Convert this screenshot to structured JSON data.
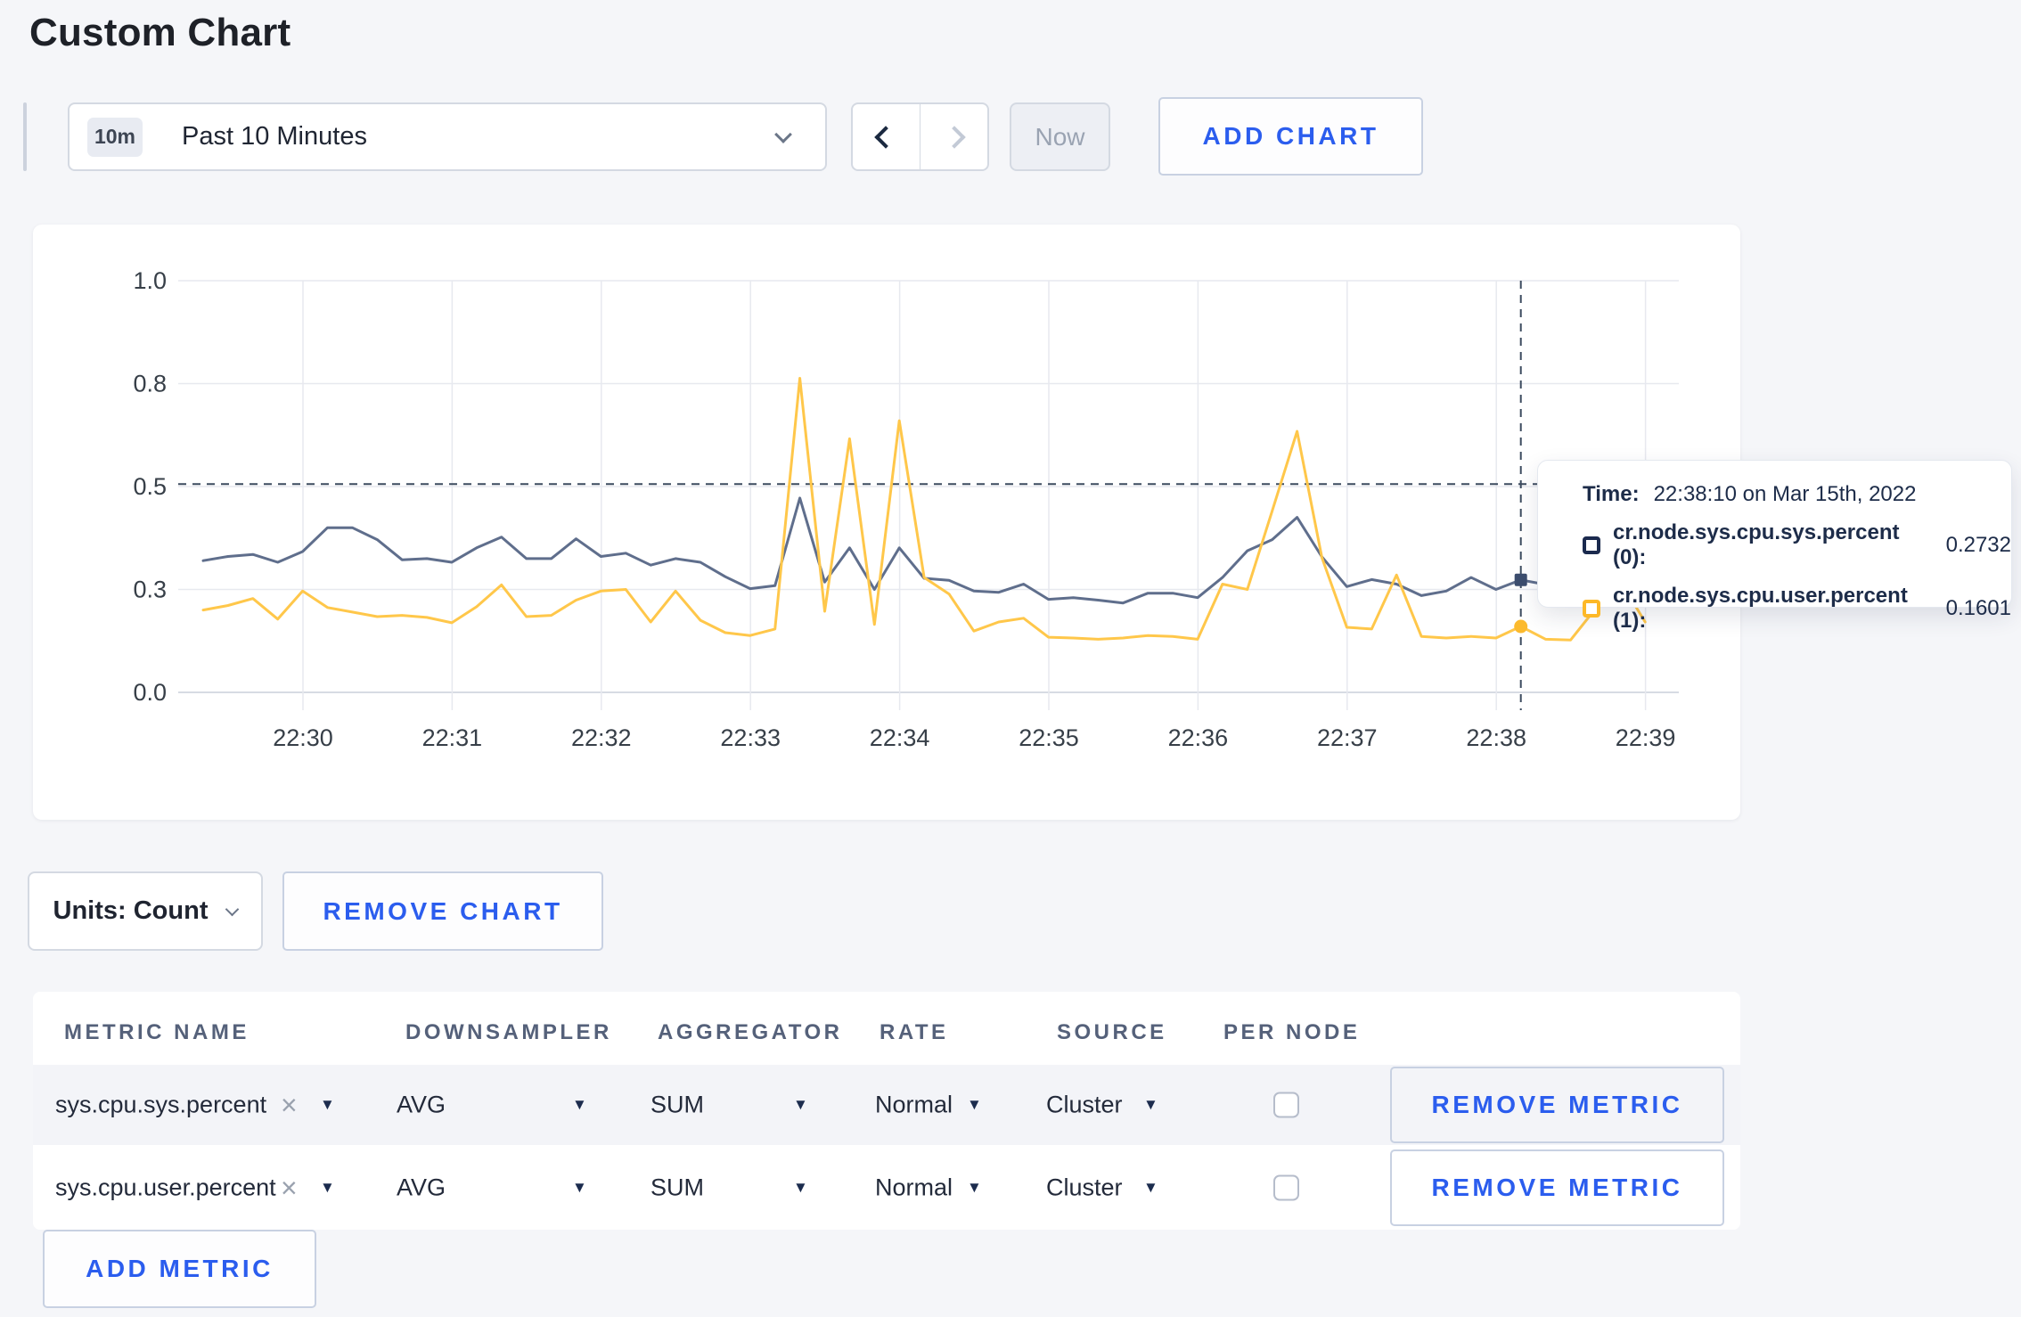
{
  "page": {
    "title": "Custom Chart",
    "background": "#f5f6f9",
    "accent_blue": "#2b5dee"
  },
  "icons": {
    "close": "×",
    "caret": "▼"
  },
  "toolbar": {
    "time_range": {
      "badge": "10m",
      "label": "Past 10 Minutes"
    },
    "now_label": "Now",
    "add_chart_label": "ADD CHART"
  },
  "tooltip": {
    "time_label": "Time:",
    "time_value": "22:38:10 on Mar 15th, 2022",
    "rows": [
      {
        "name": "cr.node.sys.cpu.sys.percent (0):",
        "value": "0.2732",
        "swatch": "#1b2a4e"
      },
      {
        "name": "cr.node.sys.cpu.user.percent (1):",
        "value": "0.1601",
        "swatch": "#fdb827"
      }
    ]
  },
  "units_row": {
    "units_label": "Units: Count",
    "remove_chart_label": "REMOVE CHART"
  },
  "metrics_table": {
    "columns": [
      "METRIC NAME",
      "DOWNSAMPLER",
      "AGGREGATOR",
      "RATE",
      "SOURCE",
      "PER NODE"
    ],
    "rows": [
      {
        "metric": "sys.cpu.sys.percent",
        "downsampler": "AVG",
        "aggregator": "SUM",
        "rate": "Normal",
        "source": "Cluster",
        "per_node_checked": false,
        "remove_label": "REMOVE METRIC"
      },
      {
        "metric": "sys.cpu.user.percent",
        "downsampler": "AVG",
        "aggregator": "SUM",
        "rate": "Normal",
        "source": "Cluster",
        "per_node_checked": false,
        "remove_label": "REMOVE METRIC"
      }
    ],
    "add_metric_label": "ADD METRIC"
  },
  "chart_data": {
    "type": "line",
    "title": "",
    "xlabel": "",
    "ylabel": "",
    "ylim": [
      0,
      1
    ],
    "grid": true,
    "x_start": "22:29:20",
    "x_step_seconds": 10,
    "x_tick_labels": [
      "22:30",
      "22:31",
      "22:32",
      "22:33",
      "22:34",
      "22:35",
      "22:36",
      "22:37",
      "22:38",
      "22:39"
    ],
    "y_tick_labels": [
      "0.0",
      "0.3",
      "0.5",
      "0.8",
      "1.0"
    ],
    "y_tick_values": [
      0,
      0.25,
      0.5,
      0.75,
      1.0
    ],
    "series": [
      {
        "name": "cr.node.sys.cpu.sys.percent",
        "color": "#5f6e8c",
        "marker_color": "#3c4d6e",
        "values": [
          0.32,
          0.33,
          0.335,
          0.316,
          0.342,
          0.4,
          0.4,
          0.371,
          0.322,
          0.325,
          0.316,
          0.351,
          0.377,
          0.325,
          0.325,
          0.373,
          0.33,
          0.338,
          0.309,
          0.325,
          0.316,
          0.281,
          0.252,
          0.259,
          0.472,
          0.268,
          0.351,
          0.25,
          0.351,
          0.277,
          0.272,
          0.246,
          0.243,
          0.263,
          0.226,
          0.23,
          0.224,
          0.217,
          0.241,
          0.241,
          0.23,
          0.279,
          0.344,
          0.371,
          0.425,
          0.329,
          0.257,
          0.274,
          0.263,
          0.235,
          0.246,
          0.279,
          0.25,
          0.2732,
          0.262,
          0.255,
          0.264,
          0.272,
          0.26
        ]
      },
      {
        "name": "cr.node.sys.cpu.user.percent",
        "color": "#ffc74a",
        "marker_color": "#fcba2d",
        "values": [
          0.2,
          0.211,
          0.228,
          0.178,
          0.246,
          0.206,
          0.195,
          0.184,
          0.187,
          0.182,
          0.169,
          0.208,
          0.261,
          0.184,
          0.187,
          0.224,
          0.246,
          0.25,
          0.171,
          0.246,
          0.175,
          0.145,
          0.138,
          0.154,
          0.763,
          0.197,
          0.616,
          0.165,
          0.66,
          0.279,
          0.239,
          0.149,
          0.171,
          0.18,
          0.134,
          0.132,
          0.129,
          0.132,
          0.138,
          0.136,
          0.129,
          0.263,
          0.25,
          0.441,
          0.634,
          0.327,
          0.158,
          0.154,
          0.285,
          0.136,
          0.132,
          0.136,
          0.132,
          0.1601,
          0.129,
          0.127,
          0.203,
          0.27,
          0.171
        ]
      }
    ],
    "crosshair": {
      "index": 53,
      "time": "22:38:10",
      "hline_value": 0.506,
      "marker_values": [
        0.2732,
        0.1601
      ],
      "dash_color": "#3c4b5f"
    },
    "legend_position": "tooltip"
  }
}
